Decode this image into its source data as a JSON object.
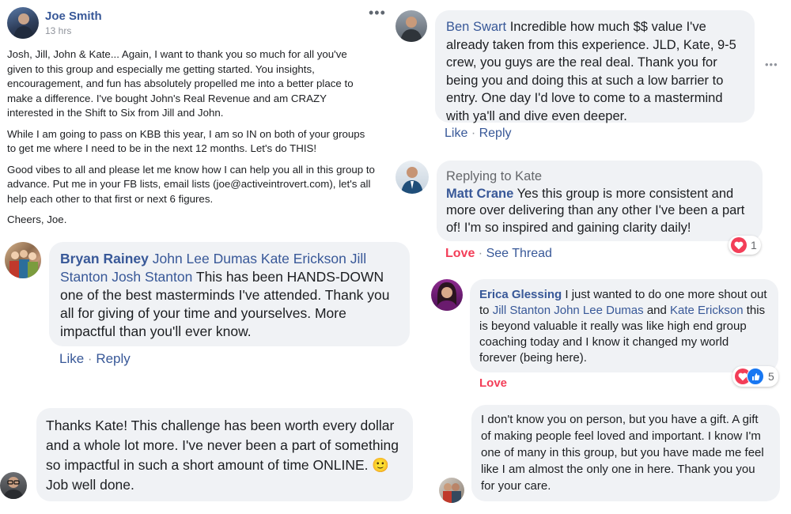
{
  "post": {
    "author": "Joe Smith",
    "time": "13 hrs",
    "p1": "Josh, Jill, John & Kate... Again, I want to thank you so much for all you've given to this group and especially me getting started. You insights, encouragement, and fun has absolutely propelled me into a better place to make a difference. I've bought John's Real Revenue and am CRAZY interested in the Shift to Six from Jill and John.",
    "p2": "While I am going to pass on KBB this year, I am so IN on both of your groups to get me where I need to be in the next 12 months. Let's do THIS!",
    "p3": "Good vibes to all and please let me know how I can help you all in this group to advance. Put me in your FB lists, email lists (joe@activeintrovert.com), let's all help each other to that first or next 6 figures.",
    "p4": "Cheers, Joe.",
    "more_icon": "more-horizontal-icon"
  },
  "bryan": {
    "name": "Bryan Rainey",
    "tags": "John Lee Dumas Kate Erickson Jill Stanton Josh Stanton",
    "text": "This has been HANDS-DOWN one of the best masterminds I've attended. Thank you all for giving of your time and yourselves. More impactful than you'll ever know.",
    "like": "Like",
    "sep": "·",
    "reply": "Reply"
  },
  "thanks": {
    "text": "Thanks Kate! This challenge has been worth every dollar and a whole lot more. I've never been a part of something so impactful in such a short amount of time ONLINE.",
    "emoji": "🙂",
    "tail": "Job well done."
  },
  "ben": {
    "name": "Ben Swart",
    "text": "Incredible how much $$ value I've already taken from this experience. JLD, Kate, 9-5 crew, you guys are the real deal. Thank you for being you and doing this at such a low barrier to entry. One day I'd love to come to a mastermind with ya'll and dive even deeper.",
    "like": "Like",
    "sep": "·",
    "reply": "Reply"
  },
  "matt": {
    "replying": "Replying to Kate",
    "name": "Matt Crane",
    "text": "Yes this group is more consistent and more over delivering than any other I've been a part of! I'm so inspired and gaining clarity daily!",
    "love": "Love",
    "sep": "·",
    "see_thread": "See Thread",
    "reaction_count": "1"
  },
  "erica": {
    "name": "Erica Glessing",
    "text1": "I just wanted to do one more shout out to",
    "tag1": "Jill Stanton John Lee Dumas",
    "and": "and",
    "tag2": "Kate Erickson",
    "text2": "this is beyond valuable it really was like high end group coaching today and I know it changed my world forever (being here).",
    "love": "Love",
    "reaction_count": "5"
  },
  "gift": {
    "text": "I don't know you on person, but you have a gift. A gift of making people feel loved and important. I know I'm one of many in this group, but you have made me feel like I am almost the only one in here. Thank you you for your care."
  },
  "colors": {
    "link": "#385898",
    "bubble": "#f0f2f5",
    "love": "#f33e58",
    "like": "#1877f2"
  }
}
